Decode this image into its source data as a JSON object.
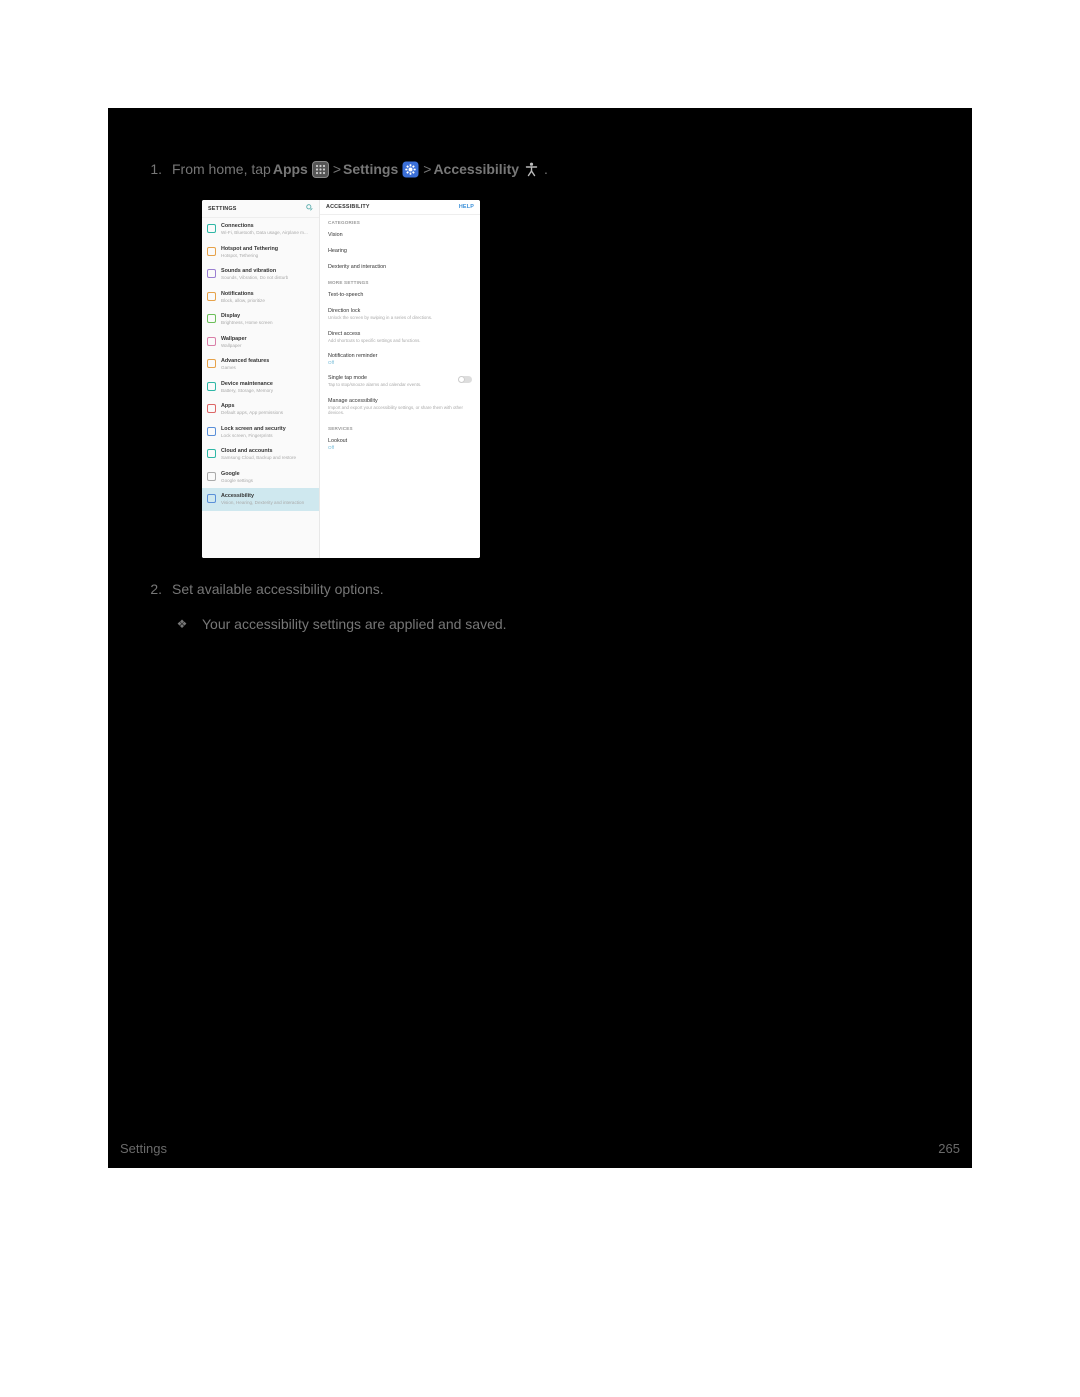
{
  "step1": {
    "num": "1.",
    "prefix": "From home, tap ",
    "apps": "Apps",
    "sep": " > ",
    "settings": "Settings",
    "accessibility": "Accessibility",
    "period": "."
  },
  "step2": {
    "num": "2.",
    "text": "Set available accessibility options."
  },
  "sub": {
    "bullet": "❖",
    "text": "Your accessibility settings are applied and saved."
  },
  "shot": {
    "left_header": "SETTINGS",
    "help": "HELP",
    "right_header": "ACCESSIBILITY",
    "left_items": [
      {
        "title": "Connections",
        "sub": "Wi-Fi, Bluetooth, Data usage, Airplane m...",
        "color": "c-teal"
      },
      {
        "title": "Hotspot and Tethering",
        "sub": "Hotspot, Tethering",
        "color": "c-orange"
      },
      {
        "title": "Sounds and vibration",
        "sub": "Sounds, Vibration, Do not disturb",
        "color": "c-purple"
      },
      {
        "title": "Notifications",
        "sub": "Block, allow, prioritize",
        "color": "c-orange"
      },
      {
        "title": "Display",
        "sub": "Brightness, Home screen",
        "color": "c-green"
      },
      {
        "title": "Wallpaper",
        "sub": "Wallpaper",
        "color": "c-pink"
      },
      {
        "title": "Advanced features",
        "sub": "Games",
        "color": "c-orange"
      },
      {
        "title": "Device maintenance",
        "sub": "Battery, Storage, Memory",
        "color": "c-teal"
      },
      {
        "title": "Apps",
        "sub": "Default apps, App permissions",
        "color": "c-red"
      },
      {
        "title": "Lock screen and security",
        "sub": "Lock screen, Fingerprints",
        "color": "c-blue"
      },
      {
        "title": "Cloud and accounts",
        "sub": "Samsung Cloud, Backup and restore",
        "color": "c-teal"
      },
      {
        "title": "Google",
        "sub": "Google settings",
        "color": "c-grey"
      },
      {
        "title": "Accessibility",
        "sub": "Vision, Hearing, Dexterity and interaction",
        "color": "c-blue",
        "selected": true
      }
    ],
    "cat1": "CATEGORIES",
    "cat2": "MORE SETTINGS",
    "cat3": "SERVICES",
    "right_items_cat1": [
      {
        "t1": "Vision"
      },
      {
        "t1": "Hearing"
      },
      {
        "t1": "Dexterity and interaction"
      }
    ],
    "right_items_cat2": [
      {
        "t1": "Text-to-speech"
      },
      {
        "t1": "Direction lock",
        "t2": "Unlock the screen by swiping in a series of directions."
      },
      {
        "t1": "Direct access",
        "t2": "Add shortcuts to specific settings and functions."
      },
      {
        "t1": "Notification reminder",
        "off": "Off"
      },
      {
        "t1": "Single tap mode",
        "t2": "Tap to stop/snooze alarms and calendar events.",
        "toggle": true
      },
      {
        "t1": "Manage accessibility",
        "t2": "Import and export your accessibility settings, or share them with other devices."
      }
    ],
    "right_items_cat3": [
      {
        "t1": "Lookout",
        "off": "Off"
      }
    ]
  },
  "footer": {
    "left": "Settings",
    "right": "265"
  }
}
